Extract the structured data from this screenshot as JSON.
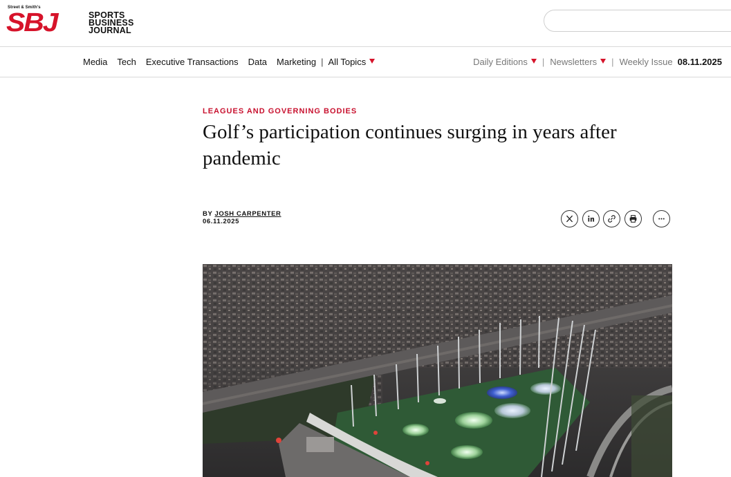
{
  "header": {
    "logo_small": "Street & Smith's",
    "logo_letters": "SBJ",
    "logo_words": [
      "SPORTS",
      "BUSINESS",
      "JOURNAL"
    ],
    "search_placeholder": ""
  },
  "nav": {
    "left_items": [
      "Media",
      "Tech",
      "Executive Transactions",
      "Data",
      "Marketing"
    ],
    "all_topics": "All Topics",
    "daily_editions": "Daily Editions",
    "newsletters": "Newsletters",
    "weekly_issue": "Weekly Issue",
    "issue_date": "08.11.2025"
  },
  "article": {
    "kicker": "LEAGUES AND GOVERNING BODIES",
    "headline": "Golf’s participation continues surging in years after pandemic",
    "by_prefix": "BY",
    "author": "JOSH CARPENTER",
    "date": "06.11.2025"
  },
  "share_icons": [
    "x-icon",
    "linkedin-icon",
    "link-icon",
    "print-icon",
    "more-icon"
  ],
  "colors": {
    "brand_red": "#d6132a",
    "kicker_red": "#c8102e",
    "turf_green": "#2f5a36"
  }
}
